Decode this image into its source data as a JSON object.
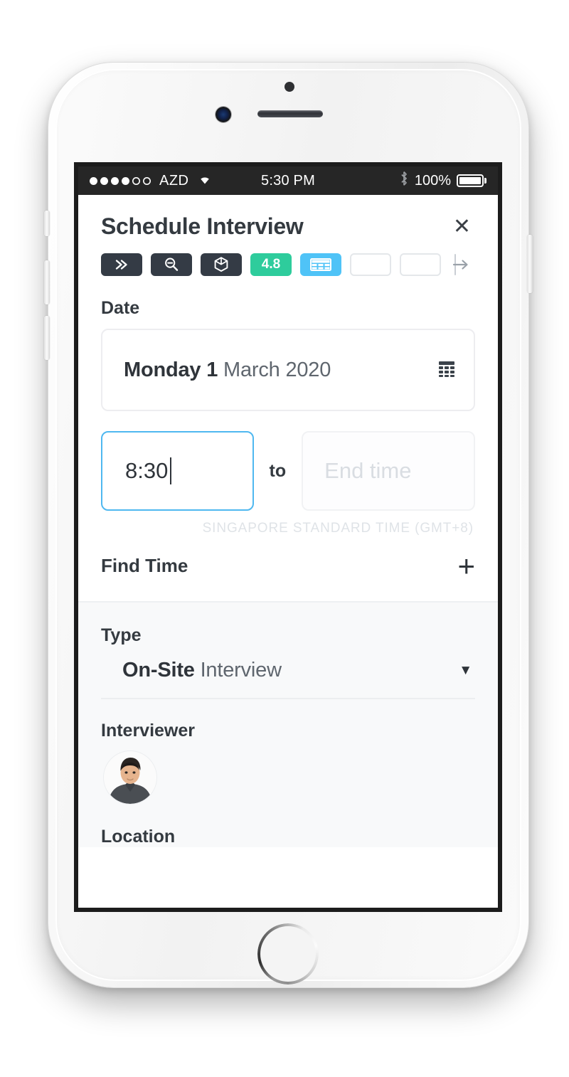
{
  "status_bar": {
    "signal_dots_filled": 4,
    "signal_dots_total": 6,
    "carrier": "AZD",
    "wifi_icon": "wifi-icon",
    "time": "5:30 PM",
    "bluetooth_icon": "bluetooth-icon",
    "battery_percent": "100%",
    "battery_icon": "battery-full-icon"
  },
  "header": {
    "title": "Schedule Interview",
    "close_icon": "✕"
  },
  "ext_toolbar": {
    "items": [
      {
        "name": "chevron-double-right-icon",
        "style": "dark",
        "label": ""
      },
      {
        "name": "search-zoom-icon",
        "style": "dark",
        "label": ""
      },
      {
        "name": "cube-3d-icon",
        "style": "dark",
        "label": ""
      },
      {
        "name": "rating-badge",
        "style": "teal",
        "label": "4.8"
      },
      {
        "name": "table-grid-icon",
        "style": "blue",
        "label": ""
      },
      {
        "name": "empty-slot-1",
        "style": "empty",
        "label": ""
      },
      {
        "name": "empty-slot-2",
        "style": "empty",
        "label": ""
      }
    ],
    "endcap_icon": "arrow-right-to-line-icon"
  },
  "form": {
    "date_label": "Date",
    "date_value_strong": "Monday 1",
    "date_value_light": "March 2020",
    "calendar_icon": "calendar-icon",
    "start_time_value": "8:30",
    "start_time_focused": true,
    "to_label": "to",
    "end_time_placeholder": "End time",
    "timezone_note": "SINGAPORE STANDARD TIME (GMT+8)",
    "find_time_label": "Find Time",
    "find_time_add_icon": "+",
    "type_label": "Type",
    "type_value_strong": "On-Site",
    "type_value_light": "Interview",
    "type_caret_icon": "▼",
    "interviewer_label": "Interviewer",
    "interviewer_avatar": "interviewer-avatar",
    "location_label": "Location"
  },
  "colors": {
    "accent_focus": "#4fb8f0",
    "badge_teal": "#2ecc9c",
    "icon_blue": "#4fc3f7",
    "toolbar_dark": "#343b45",
    "text_dark": "#343a40",
    "section_bg": "#f8f9fa"
  }
}
